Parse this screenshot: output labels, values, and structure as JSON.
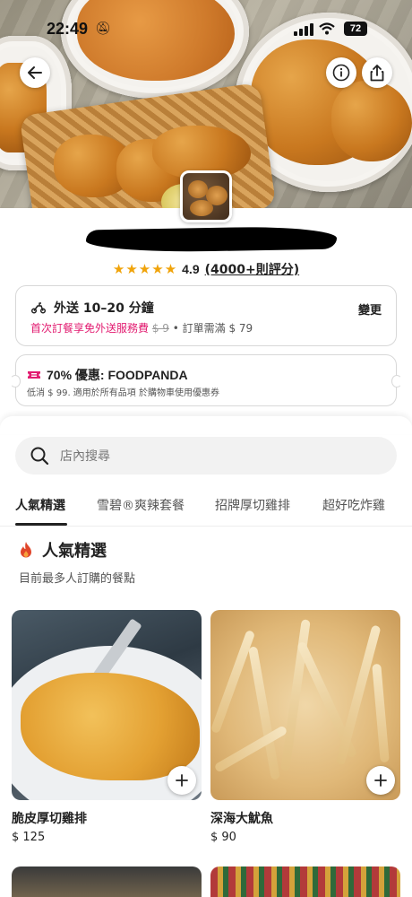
{
  "status_bar": {
    "time": "22:49",
    "battery": "72"
  },
  "restaurant": {
    "rating": "4.9",
    "rating_count": "(4000+則評分)",
    "stars": 5
  },
  "delivery": {
    "title": "外送 10–20 分鐘",
    "change_label": "變更",
    "promo": "首次訂餐享免外送服務費",
    "original_fee": "$ 9",
    "min_order": "• 訂單需滿 $ 79"
  },
  "deal": {
    "title": "70% 優惠: FOODPANDA",
    "subtitle": "低消 $ 99. 適用於所有品項 於購物車使用優惠券"
  },
  "search": {
    "placeholder": "店內搜尋"
  },
  "tabs": [
    {
      "label": "人氣精選"
    },
    {
      "label": "雪碧®爽辣套餐"
    },
    {
      "label": "招牌厚切雞排"
    },
    {
      "label": "超好吃炸雞"
    }
  ],
  "section": {
    "title": "人氣精選",
    "subtitle": "目前最多人訂購的餐點"
  },
  "products": [
    {
      "name": "脆皮厚切雞排",
      "price": "$ 125"
    },
    {
      "name": "深海大魷魚",
      "price": "$ 90"
    }
  ],
  "colors": {
    "brand_pink": "#e21b70",
    "star": "#f0a30a"
  }
}
